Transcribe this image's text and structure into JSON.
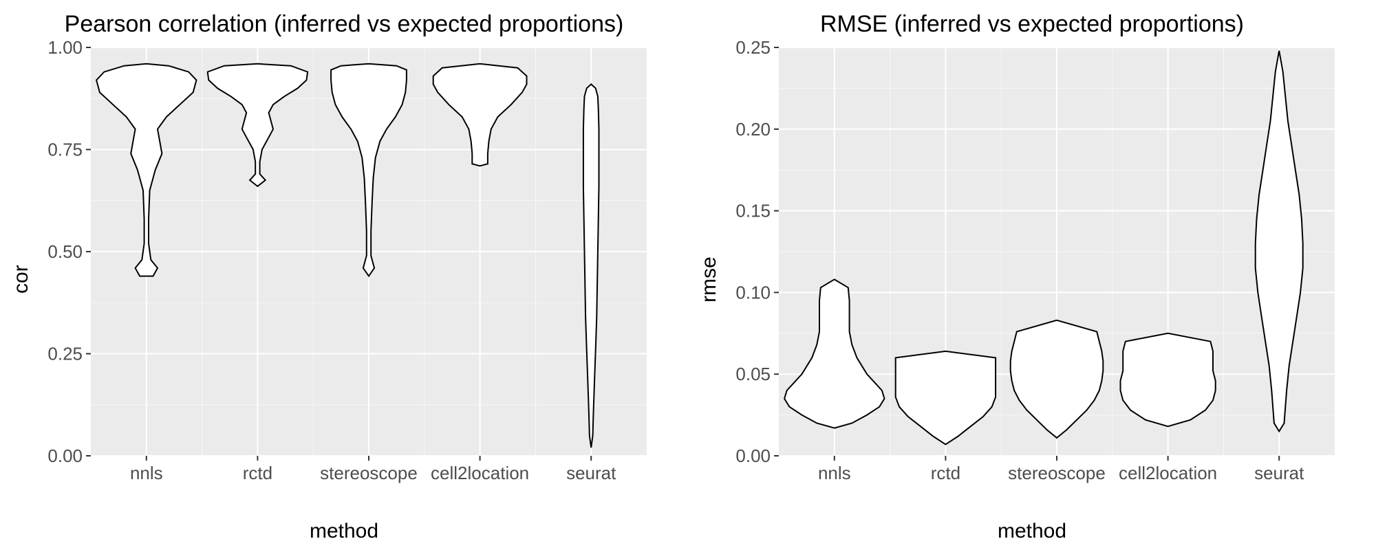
{
  "chart_data": [
    {
      "id": "left",
      "type": "violin",
      "title": "Pearson correlation (inferred vs expected proportions)",
      "xlabel": "method",
      "ylabel": "cor",
      "ylim": [
        0.0,
        1.0
      ],
      "y_major_ticks": [
        0.0,
        0.25,
        0.5,
        0.75,
        1.0
      ],
      "y_minor_ticks": [
        0.125,
        0.375,
        0.625,
        0.875
      ],
      "categories": [
        "nnls",
        "rctd",
        "stereoscope",
        "cell2location",
        "seurat"
      ],
      "max_half_width": 0.45,
      "series": [
        {
          "name": "nnls",
          "ymin": 0.44,
          "ymax": 0.96,
          "profile": [
            [
              0.44,
              0.06
            ],
            [
              0.46,
              0.1
            ],
            [
              0.48,
              0.04
            ],
            [
              0.52,
              0.02
            ],
            [
              0.58,
              0.02
            ],
            [
              0.65,
              0.03
            ],
            [
              0.7,
              0.08
            ],
            [
              0.74,
              0.14
            ],
            [
              0.77,
              0.12
            ],
            [
              0.8,
              0.1
            ],
            [
              0.83,
              0.18
            ],
            [
              0.86,
              0.3
            ],
            [
              0.89,
              0.42
            ],
            [
              0.92,
              0.45
            ],
            [
              0.94,
              0.38
            ],
            [
              0.955,
              0.2
            ],
            [
              0.96,
              0.0
            ]
          ]
        },
        {
          "name": "rctd",
          "ymin": 0.66,
          "ymax": 0.96,
          "profile": [
            [
              0.66,
              0.0
            ],
            [
              0.675,
              0.07
            ],
            [
              0.69,
              0.02
            ],
            [
              0.72,
              0.02
            ],
            [
              0.75,
              0.04
            ],
            [
              0.78,
              0.1
            ],
            [
              0.8,
              0.14
            ],
            [
              0.82,
              0.12
            ],
            [
              0.84,
              0.1
            ],
            [
              0.86,
              0.14
            ],
            [
              0.88,
              0.24
            ],
            [
              0.9,
              0.36
            ],
            [
              0.92,
              0.44
            ],
            [
              0.94,
              0.45
            ],
            [
              0.955,
              0.3
            ],
            [
              0.96,
              0.0
            ]
          ]
        },
        {
          "name": "stereoscope",
          "ymin": 0.44,
          "ymax": 0.96,
          "profile": [
            [
              0.44,
              0.0
            ],
            [
              0.46,
              0.05
            ],
            [
              0.49,
              0.02
            ],
            [
              0.55,
              0.02
            ],
            [
              0.62,
              0.03
            ],
            [
              0.68,
              0.04
            ],
            [
              0.73,
              0.06
            ],
            [
              0.77,
              0.1
            ],
            [
              0.8,
              0.16
            ],
            [
              0.83,
              0.24
            ],
            [
              0.86,
              0.3
            ],
            [
              0.89,
              0.33
            ],
            [
              0.92,
              0.34
            ],
            [
              0.945,
              0.34
            ],
            [
              0.955,
              0.25
            ],
            [
              0.96,
              0.0
            ]
          ]
        },
        {
          "name": "cell2location",
          "ymin": 0.71,
          "ymax": 0.96,
          "profile": [
            [
              0.71,
              0.0
            ],
            [
              0.715,
              0.07
            ],
            [
              0.74,
              0.07
            ],
            [
              0.77,
              0.08
            ],
            [
              0.8,
              0.1
            ],
            [
              0.83,
              0.16
            ],
            [
              0.86,
              0.28
            ],
            [
              0.89,
              0.38
            ],
            [
              0.91,
              0.42
            ],
            [
              0.93,
              0.42
            ],
            [
              0.95,
              0.34
            ],
            [
              0.96,
              0.0
            ]
          ]
        },
        {
          "name": "seurat",
          "ymin": 0.02,
          "ymax": 0.91,
          "profile": [
            [
              0.02,
              0.0
            ],
            [
              0.05,
              0.015
            ],
            [
              0.1,
              0.02
            ],
            [
              0.18,
              0.03
            ],
            [
              0.26,
              0.04
            ],
            [
              0.34,
              0.05
            ],
            [
              0.42,
              0.055
            ],
            [
              0.5,
              0.06
            ],
            [
              0.58,
              0.065
            ],
            [
              0.66,
              0.07
            ],
            [
              0.74,
              0.07
            ],
            [
              0.8,
              0.07
            ],
            [
              0.85,
              0.065
            ],
            [
              0.88,
              0.06
            ],
            [
              0.9,
              0.04
            ],
            [
              0.91,
              0.0
            ]
          ]
        }
      ]
    },
    {
      "id": "right",
      "type": "violin",
      "title": "RMSE (inferred vs expected proportions)",
      "xlabel": "method",
      "ylabel": "rmse",
      "ylim": [
        0.0,
        0.25
      ],
      "y_major_ticks": [
        0.0,
        0.05,
        0.1,
        0.15,
        0.2,
        0.25
      ],
      "y_minor_ticks": [
        0.025,
        0.075,
        0.125,
        0.175,
        0.225
      ],
      "categories": [
        "nnls",
        "rctd",
        "stereoscope",
        "cell2location",
        "seurat"
      ],
      "max_half_width": 0.45,
      "series": [
        {
          "name": "nnls",
          "ymin": 0.017,
          "ymax": 0.108,
          "profile": [
            [
              0.017,
              0.0
            ],
            [
              0.02,
              0.14
            ],
            [
              0.025,
              0.26
            ],
            [
              0.03,
              0.36
            ],
            [
              0.035,
              0.4
            ],
            [
              0.04,
              0.38
            ],
            [
              0.045,
              0.32
            ],
            [
              0.05,
              0.26
            ],
            [
              0.055,
              0.22
            ],
            [
              0.06,
              0.18
            ],
            [
              0.068,
              0.14
            ],
            [
              0.076,
              0.12
            ],
            [
              0.085,
              0.12
            ],
            [
              0.095,
              0.12
            ],
            [
              0.103,
              0.11
            ],
            [
              0.108,
              0.0
            ]
          ]
        },
        {
          "name": "rctd",
          "ymin": 0.007,
          "ymax": 0.064,
          "profile": [
            [
              0.007,
              0.0
            ],
            [
              0.012,
              0.1
            ],
            [
              0.018,
              0.2
            ],
            [
              0.024,
              0.3
            ],
            [
              0.03,
              0.37
            ],
            [
              0.036,
              0.4
            ],
            [
              0.042,
              0.4
            ],
            [
              0.048,
              0.4
            ],
            [
              0.054,
              0.4
            ],
            [
              0.06,
              0.4
            ],
            [
              0.064,
              0.0
            ]
          ]
        },
        {
          "name": "stereoscope",
          "ymin": 0.011,
          "ymax": 0.083,
          "profile": [
            [
              0.011,
              0.0
            ],
            [
              0.016,
              0.08
            ],
            [
              0.022,
              0.16
            ],
            [
              0.028,
              0.24
            ],
            [
              0.034,
              0.3
            ],
            [
              0.04,
              0.34
            ],
            [
              0.046,
              0.36
            ],
            [
              0.052,
              0.37
            ],
            [
              0.058,
              0.37
            ],
            [
              0.064,
              0.36
            ],
            [
              0.07,
              0.34
            ],
            [
              0.076,
              0.32
            ],
            [
              0.083,
              0.0
            ]
          ]
        },
        {
          "name": "cell2location",
          "ymin": 0.018,
          "ymax": 0.075,
          "profile": [
            [
              0.018,
              0.0
            ],
            [
              0.022,
              0.18
            ],
            [
              0.028,
              0.3
            ],
            [
              0.034,
              0.36
            ],
            [
              0.04,
              0.38
            ],
            [
              0.046,
              0.38
            ],
            [
              0.052,
              0.36
            ],
            [
              0.058,
              0.36
            ],
            [
              0.064,
              0.36
            ],
            [
              0.07,
              0.34
            ],
            [
              0.075,
              0.0
            ]
          ]
        },
        {
          "name": "seurat",
          "ymin": 0.015,
          "ymax": 0.248,
          "profile": [
            [
              0.015,
              0.0
            ],
            [
              0.02,
              0.04
            ],
            [
              0.03,
              0.05
            ],
            [
              0.04,
              0.06
            ],
            [
              0.055,
              0.08
            ],
            [
              0.07,
              0.11
            ],
            [
              0.085,
              0.14
            ],
            [
              0.1,
              0.17
            ],
            [
              0.115,
              0.19
            ],
            [
              0.13,
              0.19
            ],
            [
              0.145,
              0.18
            ],
            [
              0.16,
              0.16
            ],
            [
              0.175,
              0.13
            ],
            [
              0.19,
              0.1
            ],
            [
              0.205,
              0.07
            ],
            [
              0.22,
              0.05
            ],
            [
              0.235,
              0.03
            ],
            [
              0.248,
              0.0
            ]
          ]
        }
      ]
    }
  ]
}
